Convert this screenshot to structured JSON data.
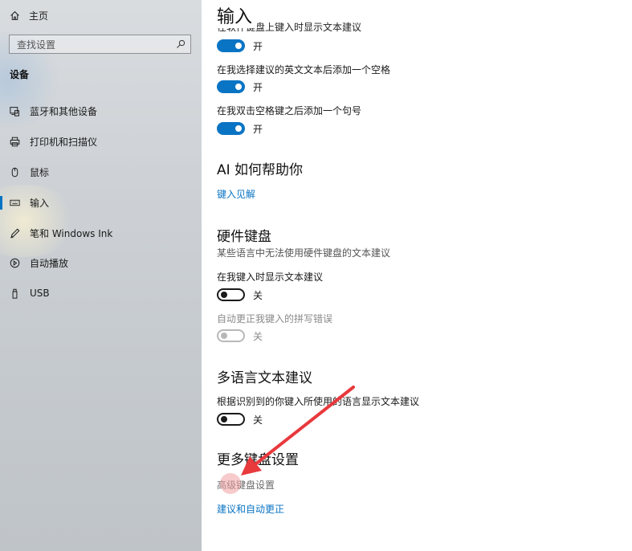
{
  "sidebar": {
    "home_label": "主页",
    "search_placeholder": "查找设置",
    "section_title": "设备",
    "items": [
      {
        "label": "蓝牙和其他设备",
        "icon": "bluetooth-devices-icon"
      },
      {
        "label": "打印机和扫描仪",
        "icon": "printer-icon"
      },
      {
        "label": "鼠标",
        "icon": "mouse-icon"
      },
      {
        "label": "输入",
        "icon": "keyboard-icon",
        "active": true
      },
      {
        "label": "笔和 Windows Ink",
        "icon": "pen-icon"
      },
      {
        "label": "自动播放",
        "icon": "autoplay-icon"
      },
      {
        "label": "USB",
        "icon": "usb-icon"
      }
    ]
  },
  "main": {
    "title": "输入",
    "cut_text": "在软件键盘上键入时显示文本建议",
    "settings_top": [
      {
        "label": "在我选择建议的英文文本后添加一个空格",
        "state": "开"
      },
      {
        "label": "在我双击空格键之后添加一个句号",
        "state": "开"
      }
    ],
    "top_toggle_state": "开",
    "ai_section": {
      "heading": "AI 如何帮助你",
      "link": "键入见解"
    },
    "hardware_section": {
      "heading": "硬件键盘",
      "description": "某些语言中无法使用硬件键盘的文本建议",
      "show_suggestions": {
        "label": "在我键入时显示文本建议",
        "state": "关"
      },
      "autocorrect": {
        "label": "自动更正我键入的拼写错误",
        "state": "关"
      }
    },
    "multilingual_section": {
      "heading": "多语言文本建议",
      "setting": {
        "label": "根据识别到的你键入所使用的语言显示文本建议",
        "state": "关"
      }
    },
    "more_section": {
      "heading": "更多键盘设置",
      "advanced_link": "高级键盘设置",
      "suggestions_link": "建议和自动更正"
    }
  },
  "colors": {
    "accent": "#0a74c4",
    "annotation_arrow": "#e8393d"
  }
}
